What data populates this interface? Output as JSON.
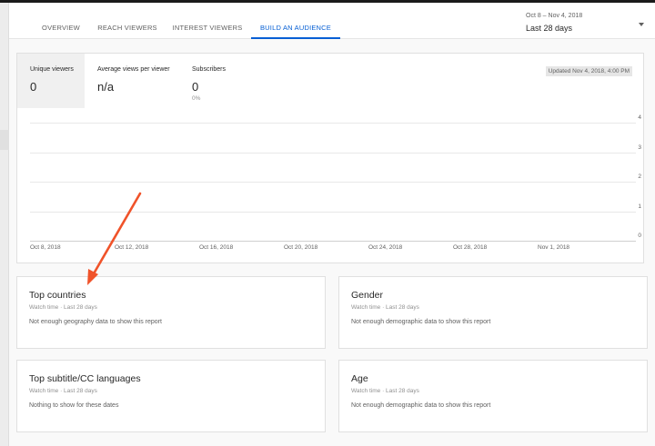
{
  "tabs": [
    {
      "label": "OVERVIEW",
      "active": false
    },
    {
      "label": "REACH VIEWERS",
      "active": false
    },
    {
      "label": "INTEREST VIEWERS",
      "active": false
    },
    {
      "label": "BUILD AN AUDIENCE",
      "active": true
    }
  ],
  "date_range": {
    "range": "Oct 8 – Nov 4, 2018",
    "period": "Last 28 days"
  },
  "metrics": [
    {
      "label": "Unique viewers",
      "value": "0",
      "selected": true
    },
    {
      "label": "Average views per viewer",
      "value": "n/a"
    },
    {
      "label": "Subscribers",
      "value": "0",
      "sub": "0%"
    }
  ],
  "updated": "Updated Nov 4, 2018, 4:00 PM",
  "chart_data": {
    "type": "line",
    "x": [
      "Oct 8, 2018",
      "Oct 12, 2018",
      "Oct 16, 2018",
      "Oct 20, 2018",
      "Oct 24, 2018",
      "Oct 28, 2018",
      "Nov 1, 2018"
    ],
    "y_ticks": [
      "4",
      "3",
      "2",
      "1",
      "0"
    ],
    "ylim": [
      0,
      4
    ],
    "series": [
      {
        "values": [
          0,
          0,
          0,
          0,
          0,
          0,
          0
        ]
      }
    ],
    "grid": true
  },
  "cards": {
    "top_countries": {
      "title": "Top countries",
      "subtitle": "Watch time · Last 28 days",
      "message": "Not enough geography data to show this report"
    },
    "gender": {
      "title": "Gender",
      "subtitle": "Watch time · Last 28 days",
      "message": "Not enough demographic data to show this report"
    },
    "languages": {
      "title": "Top subtitle/CC languages",
      "subtitle": "Watch time · Last 28 days",
      "message": "Nothing to show for these dates"
    },
    "age": {
      "title": "Age",
      "subtitle": "Watch time · Last 28 days",
      "message": "Not enough demographic data to show this report"
    }
  },
  "colors": {
    "accent": "#065fd4",
    "annotation_arrow": "#f0532a"
  }
}
